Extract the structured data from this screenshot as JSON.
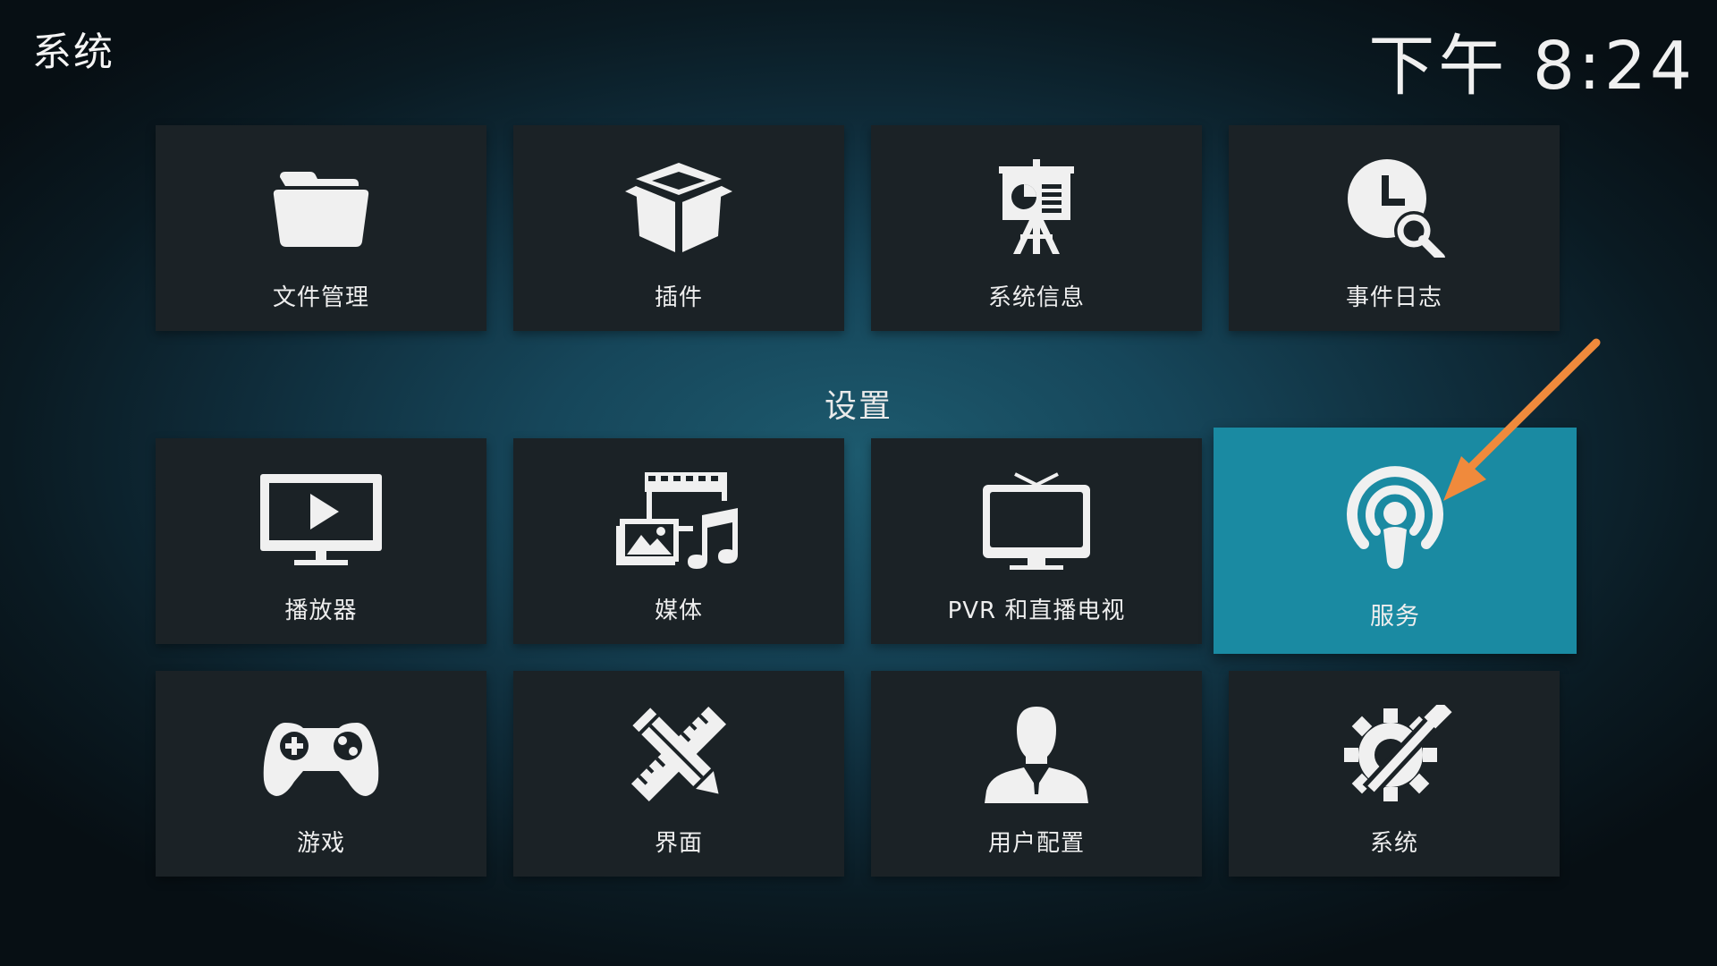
{
  "header": {
    "title": "系统",
    "clock": "下午 8:24"
  },
  "top_row": [
    {
      "label": "文件管理",
      "icon": "folder-icon"
    },
    {
      "label": "插件",
      "icon": "package-box-icon"
    },
    {
      "label": "系统信息",
      "icon": "presentation-easel-icon"
    },
    {
      "label": "事件日志",
      "icon": "clock-search-icon"
    }
  ],
  "settings": {
    "heading": "设置",
    "items": [
      {
        "label": "播放器",
        "icon": "tv-play-icon"
      },
      {
        "label": "媒体",
        "icon": "media-film-music-icon"
      },
      {
        "label": "PVR 和直播电视",
        "icon": "tv-antenna-icon"
      },
      {
        "label": "服务",
        "icon": "podcast-broadcast-icon",
        "focused": true
      },
      {
        "label": "游戏",
        "icon": "gamepad-icon"
      },
      {
        "label": "界面",
        "icon": "pencil-ruler-icon"
      },
      {
        "label": "用户配置",
        "icon": "user-profile-icon"
      },
      {
        "label": "系统",
        "icon": "gear-tools-icon"
      }
    ]
  },
  "colors": {
    "tile_bg": "#1b2226",
    "focus_bg": "#1a8aa2",
    "annotation_arrow": "#f08a3c",
    "icon": "#f0f0f0"
  }
}
